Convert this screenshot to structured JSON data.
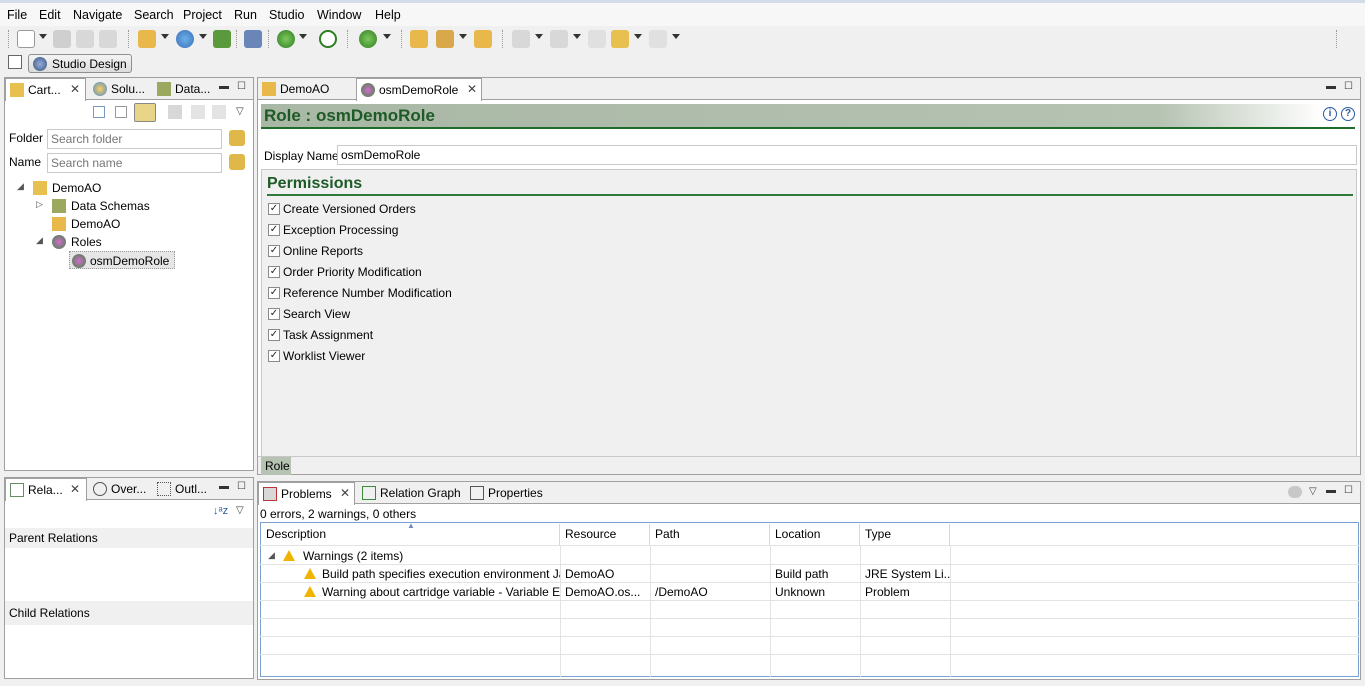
{
  "menu": [
    "File",
    "Edit",
    "Navigate",
    "Search",
    "Project",
    "Run",
    "Studio",
    "Window",
    "Help"
  ],
  "perspective": {
    "label": "Studio Design"
  },
  "left_top": {
    "tabs": [
      {
        "label": "Cart...",
        "closable": true
      },
      {
        "label": "Solu..."
      },
      {
        "label": "Data..."
      }
    ],
    "folder_label": "Folder",
    "folder_placeholder": "Search folder",
    "name_label": "Name",
    "name_placeholder": "Search name",
    "tree": [
      {
        "label": "DemoAO",
        "level": 0,
        "expanded": true
      },
      {
        "label": "Data Schemas",
        "level": 1,
        "expanded": false
      },
      {
        "label": "DemoAO",
        "level": 1
      },
      {
        "label": "Roles",
        "level": 1,
        "expanded": true
      },
      {
        "label": "osmDemoRole",
        "level": 2,
        "selected": true
      }
    ]
  },
  "left_bottom": {
    "tabs": [
      {
        "label": "Rela...",
        "closable": true
      },
      {
        "label": "Over..."
      },
      {
        "label": "Outl..."
      }
    ],
    "parent_relations": "Parent Relations",
    "child_relations": "Child Relations"
  },
  "editor": {
    "tabs": [
      {
        "label": "DemoAO"
      },
      {
        "label": "osmDemoRole",
        "active": true,
        "closable": true
      }
    ],
    "header_title": "Role : osmDemoRole",
    "display_name_label": "Display Name",
    "display_name_value": "osmDemoRole",
    "permissions_title": "Permissions",
    "permissions": [
      "Create Versioned Orders",
      "Exception Processing",
      "Online Reports",
      "Order Priority Modification",
      "Reference Number Modification",
      "Search View",
      "Task Assignment",
      "Worklist Viewer"
    ],
    "bottom_tab": "Role"
  },
  "problems": {
    "tabs": [
      {
        "label": "Problems",
        "active": true,
        "closable": true
      },
      {
        "label": "Relation Graph"
      },
      {
        "label": "Properties"
      }
    ],
    "summary": "0 errors, 2 warnings, 0 others",
    "columns": [
      "Description",
      "Resource",
      "Path",
      "Location",
      "Type"
    ],
    "group": "Warnings (2 items)",
    "rows": [
      {
        "description": "Build path specifies execution environment Ja",
        "resource": "DemoAO",
        "path": "",
        "location": "Build path",
        "type": "JRE System Li..."
      },
      {
        "description": "Warning about cartridge variable  - Variable E",
        "resource": "DemoAO.os...",
        "path": "/DemoAO",
        "location": "Unknown",
        "type": "Problem"
      }
    ]
  },
  "colors": {
    "header_green": "#1e6b2a",
    "header_bg": "#a9b7a5",
    "accent": "#2d7a3a"
  }
}
